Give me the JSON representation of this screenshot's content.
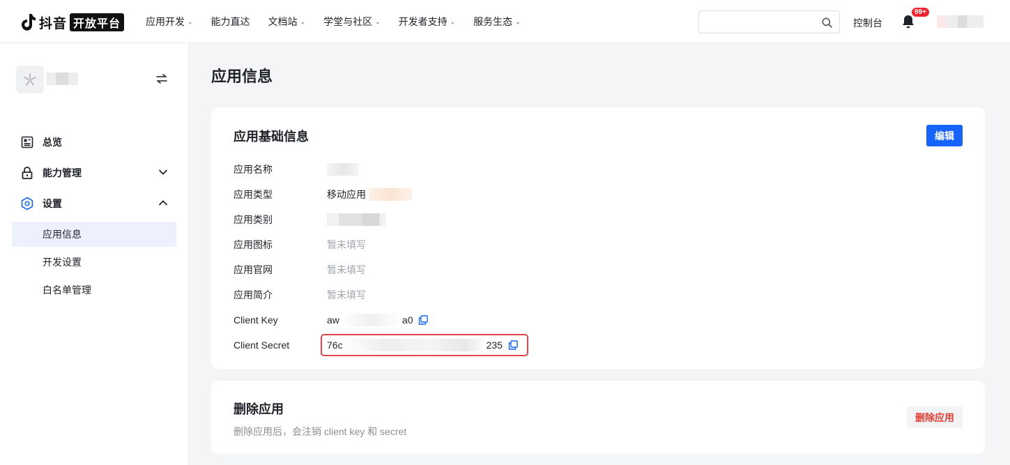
{
  "brand": {
    "name": "抖音",
    "badge": "开放平台"
  },
  "nav": {
    "items": [
      {
        "label": "应用开发",
        "has_caret": true
      },
      {
        "label": "能力直达",
        "has_caret": false
      },
      {
        "label": "文档站",
        "has_caret": true
      },
      {
        "label": "学堂与社区",
        "has_caret": true
      },
      {
        "label": "开发者支持",
        "has_caret": true
      },
      {
        "label": "服务生态",
        "has_caret": true
      }
    ],
    "search_placeholder": "",
    "console_label": "控制台",
    "notification_badge": "99+"
  },
  "sidebar": {
    "menu": [
      {
        "label": "总览",
        "icon": "dashboard-icon"
      },
      {
        "label": "能力管理",
        "icon": "lock-icon",
        "expanded": false
      },
      {
        "label": "设置",
        "icon": "settings-hexagon-icon",
        "expanded": true
      }
    ],
    "sub_items": [
      {
        "label": "应用信息",
        "active": true
      },
      {
        "label": "开发设置",
        "active": false
      },
      {
        "label": "白名单管理",
        "active": false
      }
    ]
  },
  "main": {
    "page_title": "应用信息",
    "basic_info": {
      "title": "应用基础信息",
      "edit_label": "编辑",
      "fields": [
        {
          "label": "应用名称",
          "value": ""
        },
        {
          "label": "应用类型",
          "value": "移动应用"
        },
        {
          "label": "应用类别",
          "value": ""
        },
        {
          "label": "应用图标",
          "value": "暂未填写"
        },
        {
          "label": "应用官网",
          "value": "暂未填写"
        },
        {
          "label": "应用简介",
          "value": "暂未填写"
        },
        {
          "label": "Client Key",
          "value_prefix": "aw",
          "value_suffix": "a0"
        },
        {
          "label": "Client Secret",
          "value_prefix": "76c",
          "value_suffix": "235"
        }
      ]
    },
    "delete_app": {
      "title": "删除应用",
      "description": "删除应用后，会注销 client key 和 secret",
      "button_label": "删除应用"
    }
  },
  "colors": {
    "primary": "#1664ff",
    "danger": "#e33e33",
    "highlight_border": "#e2464b"
  }
}
